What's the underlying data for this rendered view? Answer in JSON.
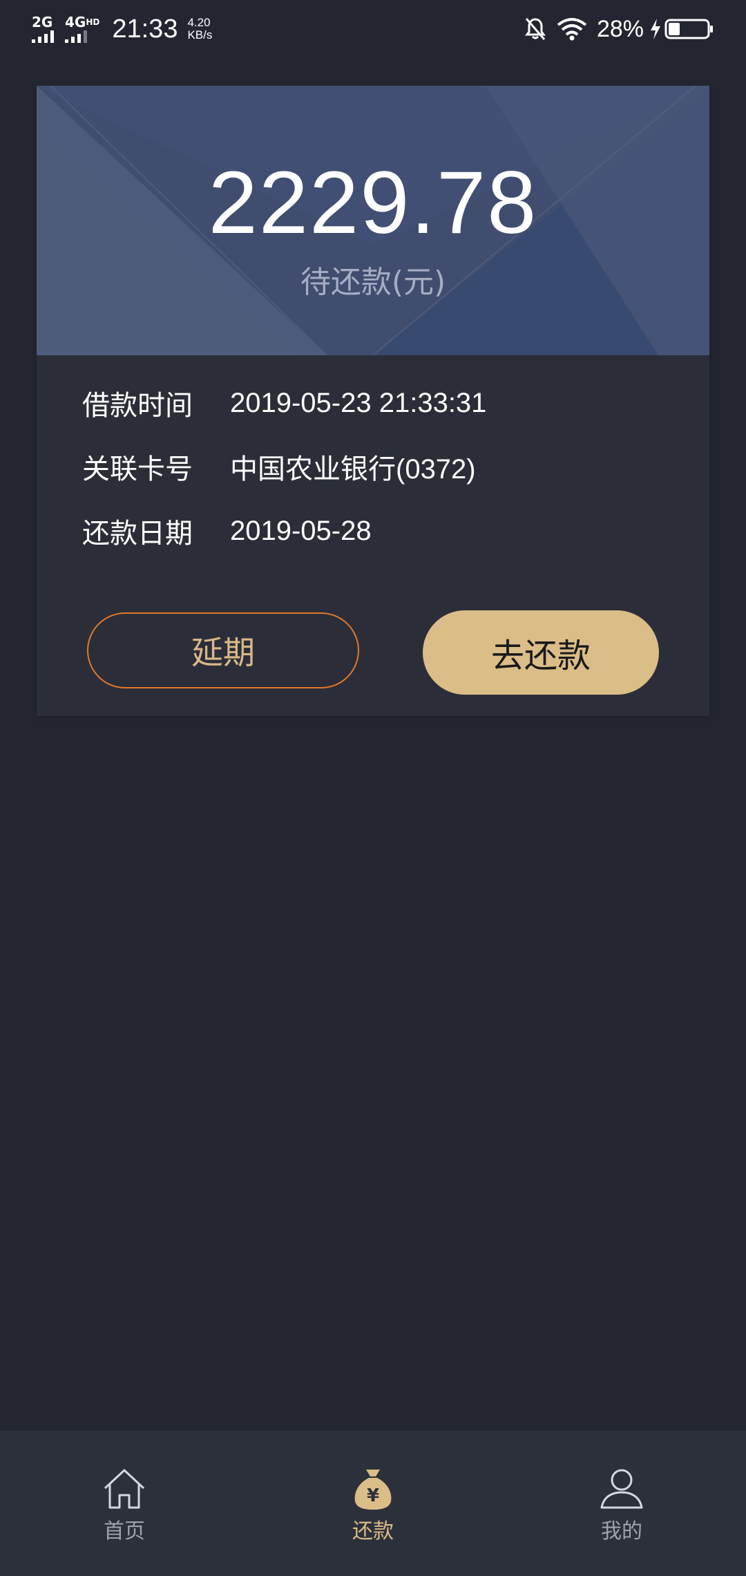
{
  "status_bar": {
    "sim1_label": "2G",
    "sim2_label": "4G",
    "sim2_suffix": "HD",
    "time": "21:33",
    "speed_value": "4.20",
    "speed_unit": "KB/s",
    "battery_percent": "28%",
    "icons": [
      "mute-bell-icon",
      "wifi-icon",
      "charging-bolt-icon",
      "battery-icon"
    ]
  },
  "card": {
    "amount": "2229.78",
    "amount_label": "待还款(元)",
    "rows": [
      {
        "label": "借款时间",
        "value": "2019-05-23 21:33:31"
      },
      {
        "label": "关联卡号",
        "value": "中国农业银行(0372)"
      },
      {
        "label": "还款日期",
        "value": "2019-05-28"
      }
    ],
    "extend_button": "延期",
    "repay_button": "去还款"
  },
  "bottom_nav": {
    "items": [
      {
        "label": "首页",
        "icon": "home-icon",
        "active": false
      },
      {
        "label": "还款",
        "icon": "money-bag-icon",
        "active": true
      },
      {
        "label": "我的",
        "icon": "user-icon",
        "active": false
      }
    ]
  },
  "colors": {
    "background": "#232631",
    "card": "#2b2e39",
    "header": "#3f4c6d",
    "accent_gold": "#dbbd87",
    "accent_orange": "#e3782a",
    "nav_background": "#2c303b"
  }
}
